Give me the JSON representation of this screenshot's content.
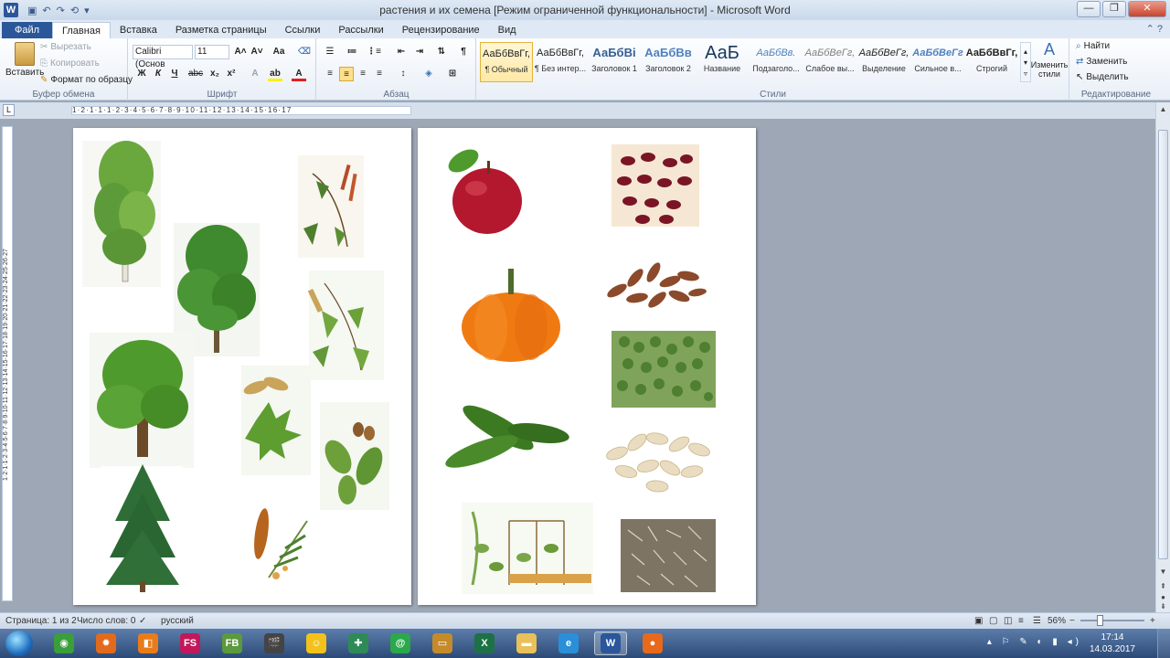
{
  "window": {
    "title": "растения и их семена [Режим ограниченной функциональности]  -  Microsoft Word",
    "app_icon_letter": "W",
    "qat": [
      "↶",
      "↷",
      "⟲",
      "▾"
    ],
    "controls": [
      "—",
      "❐",
      "✕"
    ]
  },
  "tabs": {
    "file": "Файл",
    "items": [
      "Главная",
      "Вставка",
      "Разметка страницы",
      "Ссылки",
      "Рассылки",
      "Рецензирование",
      "Вид"
    ],
    "active_index": 0,
    "right_icons": "⌃ ?"
  },
  "ribbon": {
    "clipboard": {
      "label": "Буфер обмена",
      "paste": "Вставить",
      "cut": "Вырезать",
      "copy": "Копировать",
      "format_painter": "Формат по образцу"
    },
    "font": {
      "label": "Шрифт",
      "font_name": "Calibri (Основ",
      "font_size": "11",
      "grow": "A˄",
      "shrink": "A˅",
      "case": "Aa",
      "clear": "⌫",
      "bold": "Ж",
      "italic": "К",
      "underline": "Ч",
      "strike": "abc",
      "sub": "x₂",
      "sup": "x²",
      "effects": "A",
      "highlight": "ab",
      "color": "A"
    },
    "paragraph": {
      "label": "Абзац",
      "row1": [
        "☰",
        "≔",
        "⋮≡",
        "⇤",
        "⇥",
        "⇅",
        "¶"
      ],
      "row2": [
        "≡",
        "≡",
        "≡",
        "≡",
        "↕",
        "◈",
        "⊞"
      ]
    },
    "styles": {
      "label": "Стили",
      "items": [
        {
          "sample": "АаБбВвГг,",
          "name": "¶ Обычный",
          "color": "#222222"
        },
        {
          "sample": "АаБбВвГг,",
          "name": "¶ Без интер...",
          "color": "#222222"
        },
        {
          "sample": "АаБбВі",
          "name": "Заголовок 1",
          "color": "#365f91"
        },
        {
          "sample": "АаБбВв",
          "name": "Заголовок 2",
          "color": "#4f81bd"
        },
        {
          "sample": "АаБ",
          "name": "Название",
          "color": "#17365d"
        },
        {
          "sample": "АаБбВв.",
          "name": "Подзаголо...",
          "color": "#4f81bd"
        },
        {
          "sample": "АаБбВеГг,",
          "name": "Слабое вы...",
          "color": "#808080"
        },
        {
          "sample": "АаБбВеГг,",
          "name": "Выделение",
          "color": "#222222"
        },
        {
          "sample": "АаБбВеГг",
          "name": "Сильное в...",
          "color": "#4f81bd"
        },
        {
          "sample": "АаБбВвГг,",
          "name": "Строгий",
          "color": "#222222"
        }
      ],
      "selected_index": 0,
      "change_styles": "Изменить стили"
    },
    "editing": {
      "label": "Редактирование",
      "find": "Найти",
      "replace": "Заменить",
      "select": "Выделить"
    }
  },
  "ruler": {
    "horizontal": "1·2·1·1·1·2·3·4·5·6·7·8·9·10·11·12·13·14·15·16·17",
    "vertical": "1·2·1·1·2·3·4·5·6·7·8·9·10·11·12·13·14·15·16·17·18·19·20·21·22·23·24·25·26·27",
    "corner": "L"
  },
  "pictures": {
    "page1": [
      {
        "name": "birch-tree",
        "color": "#5d9b3a"
      },
      {
        "name": "birch-branch-with-catkins",
        "color": "#6a8f3b"
      },
      {
        "name": "linden-tree",
        "color": "#3f8a2f"
      },
      {
        "name": "birch-leaves-with-seeds",
        "color": "#72a83e"
      },
      {
        "name": "oak-tree",
        "color": "#4f9a2c"
      },
      {
        "name": "maple-leaf-with-seeds",
        "color": "#5e9e30"
      },
      {
        "name": "oak-leaves-with-acorns",
        "color": "#6da03a"
      },
      {
        "name": "spruce-tree",
        "color": "#2e6e36"
      },
      {
        "name": "spruce-cone-branch",
        "color": "#b5651d"
      }
    ],
    "page2": [
      {
        "name": "red-apple",
        "color": "#b3182e"
      },
      {
        "name": "red-beans",
        "color": "#7a1525"
      },
      {
        "name": "almond-like-seeds",
        "color": "#8b4a2b"
      },
      {
        "name": "orange-pumpkin",
        "color": "#f07a12"
      },
      {
        "name": "green-peas",
        "color": "#5f8f3a"
      },
      {
        "name": "cucumbers",
        "color": "#3c7a22"
      },
      {
        "name": "pumpkin-seeds",
        "color": "#e9dcc0"
      },
      {
        "name": "pea-plants-on-trellis",
        "color": "#7aa64a"
      },
      {
        "name": "sunflower-seeds",
        "color": "#7d7463"
      }
    ]
  },
  "status": {
    "page": "Страница: 1 из 2",
    "words": "Число слов: 0",
    "language": "русский",
    "zoom": "56%",
    "zoom_minus": "−",
    "zoom_plus": "+"
  },
  "taskbar": {
    "icons": [
      {
        "name": "browser-globe-icon",
        "label": "◉",
        "color": "#3a9e3a"
      },
      {
        "name": "media-player-icon",
        "label": "✹",
        "color": "#e26a1c"
      },
      {
        "name": "office-app-icon",
        "label": "◧",
        "color": "#e87c1a"
      },
      {
        "name": "fs-app-icon",
        "label": "FS",
        "color": "#c2185b"
      },
      {
        "name": "file-manager-icon",
        "label": "FB",
        "color": "#5b9a3c"
      },
      {
        "name": "video-editor-icon",
        "label": "🎬",
        "color": "#444444"
      },
      {
        "name": "pro-app-icon",
        "label": "☺",
        "color": "#f2c21b"
      },
      {
        "name": "green-circle-app-icon",
        "label": "✚",
        "color": "#2e8b57"
      },
      {
        "name": "mail-agent-icon",
        "label": "@",
        "color": "#2aa84a"
      },
      {
        "name": "dictionary-app-icon",
        "label": "▭",
        "color": "#c58b2a"
      },
      {
        "name": "excel-icon",
        "label": "X",
        "color": "#1e7145"
      },
      {
        "name": "explorer-folder-icon",
        "label": "▬",
        "color": "#e8c15a"
      },
      {
        "name": "internet-explorer-icon",
        "label": "e",
        "color": "#2a8fd8"
      },
      {
        "name": "word-icon",
        "label": "W",
        "color": "#2b579a"
      },
      {
        "name": "firefox-icon",
        "label": "●",
        "color": "#e8691a"
      }
    ],
    "active_index": 13,
    "tray": "▴ ⚐ ✎ ◐ ▮ ◂)",
    "time": "17:14",
    "date": "14.03.2017"
  }
}
